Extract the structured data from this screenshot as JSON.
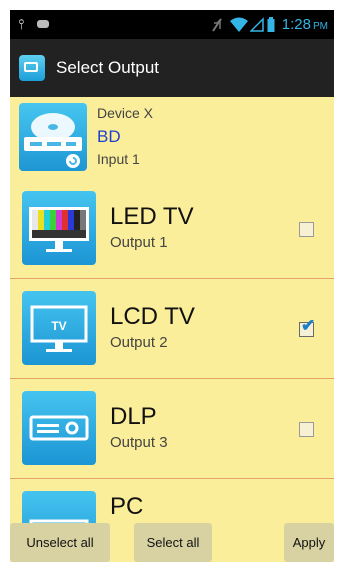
{
  "statusbar": {
    "time": "1:28",
    "ampm": "PM",
    "icons": [
      "usb-icon",
      "gamepad-icon",
      "mute-icon",
      "wifi-icon",
      "signal-icon",
      "battery-icon"
    ]
  },
  "actionbar": {
    "title": "Select Output",
    "icon": "output-icon"
  },
  "source": {
    "name": "Device X",
    "type": "BD",
    "input": "Input 1",
    "icon": "bluray-player-icon"
  },
  "outputs": [
    {
      "title": "LED TV",
      "subtitle": "Output 1",
      "checked": false,
      "icon": "led-tv-icon"
    },
    {
      "title": "LCD TV",
      "subtitle": "Output 2",
      "checked": true,
      "icon": "lcd-tv-icon"
    },
    {
      "title": "DLP",
      "subtitle": "Output 3",
      "checked": false,
      "icon": "projector-icon"
    },
    {
      "title": "PC",
      "subtitle": "",
      "checked": false,
      "icon": "pc-icon"
    }
  ],
  "buttons": {
    "unselect_all": "Unselect all",
    "select_all": "Select all",
    "apply": "Apply"
  },
  "colors": {
    "background": "#fbee9a",
    "actionbar": "#222222",
    "tile": "#2aa8e0",
    "accent_time": "#33b5e5",
    "source_type": "#1f3fcf",
    "divider": "#e5a26a",
    "checkmark": "#1b7fc8"
  }
}
